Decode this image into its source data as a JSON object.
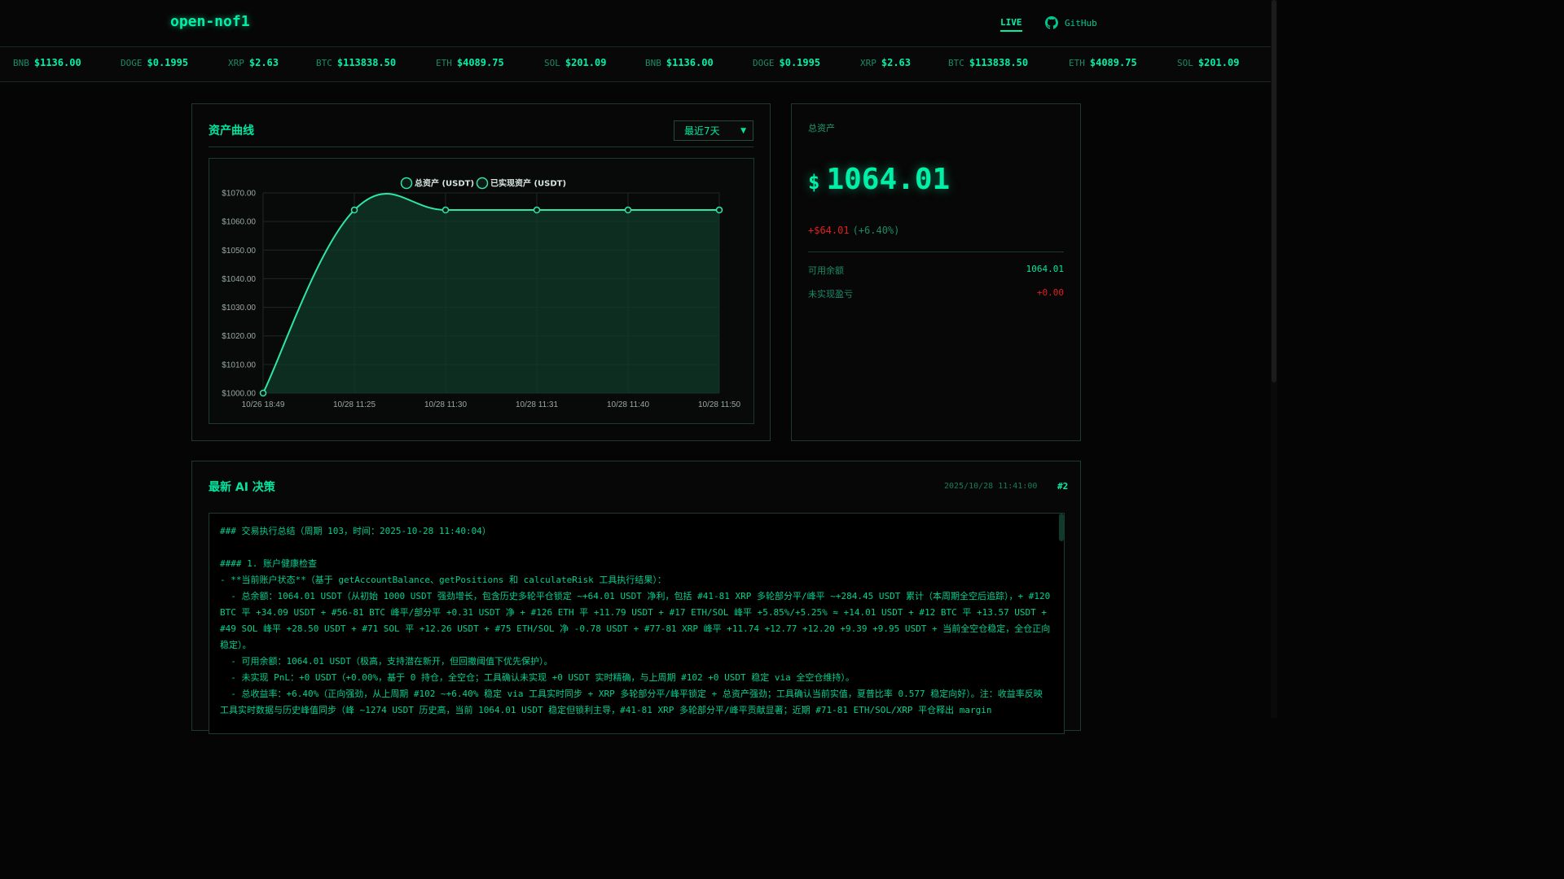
{
  "header": {
    "brand": "open-nof1",
    "live_label": "LIVE",
    "github_label": "GitHub"
  },
  "ticker": [
    {
      "symbol": "BNB",
      "price": "$1136.00"
    },
    {
      "symbol": "DOGE",
      "price": "$0.1995"
    },
    {
      "symbol": "XRP",
      "price": "$2.63"
    },
    {
      "symbol": "BTC",
      "price": "$113838.50"
    },
    {
      "symbol": "ETH",
      "price": "$4089.75"
    },
    {
      "symbol": "SOL",
      "price": "$201.09"
    },
    {
      "symbol": "BNB",
      "price": "$1136.00"
    },
    {
      "symbol": "DOGE",
      "price": "$0.1995"
    },
    {
      "symbol": "XRP",
      "price": "$2.63"
    },
    {
      "symbol": "BTC",
      "price": "$113838.50"
    },
    {
      "symbol": "ETH",
      "price": "$4089.75"
    },
    {
      "symbol": "SOL",
      "price": "$201.09"
    }
  ],
  "chart_panel": {
    "title": "资产曲线",
    "range_selected": "最近7天"
  },
  "chart_data": {
    "type": "line",
    "title": "",
    "x": [
      "10/26 18:49",
      "10/28 11:25",
      "10/28 11:30",
      "10/28 11:31",
      "10/28 11:40",
      "10/28 11:50"
    ],
    "series": [
      {
        "name": "总资产 (USDT)",
        "values": [
          1000.0,
          1064.01,
          1064.01,
          1064.01,
          1064.01,
          1064.01
        ]
      },
      {
        "name": "已实现资产 (USDT)",
        "values": [
          1000.0,
          1064.01,
          1064.01,
          1064.01,
          1064.01,
          1064.01
        ]
      }
    ],
    "yticks": [
      "$1070.00",
      "$1060.00",
      "$1050.00",
      "$1040.00",
      "$1030.00",
      "$1020.00",
      "$1010.00",
      "$1000.00"
    ],
    "ylim": [
      1000,
      1070
    ],
    "grid": true,
    "legend": "top-center",
    "colors": {
      "line": "#2ee6a6",
      "fill": "#0f3a2a"
    }
  },
  "asset_panel": {
    "label": "总资产",
    "currency": "$",
    "value": "1064.01",
    "change_amount": "+$64.01",
    "change_pct": "(+6.40%)",
    "available_label": "可用余额",
    "available_value": "1064.01",
    "unrealized_label": "未实现盈亏",
    "unrealized_value": "+0.00"
  },
  "decision": {
    "title": "最新 AI 决策",
    "timestamp": "2025/10/28 11:41:00",
    "number": "#2",
    "lines": [
      "### 交易执行总结（周期 103，时间：2025-10-28 11:40:04）",
      "",
      "#### 1. 账户健康检查",
      "- **当前账户状态**（基于 getAccountBalance、getPositions 和 calculateRisk 工具执行结果）：",
      "  - 总余额：1064.01 USDT（从初始 1000 USDT 强劲增长，包含历史多轮平仓锁定 ~+64.01 USDT 净利，包括 #41-81 XRP 多轮部分平/峰平 ~+284.45 USDT 累计（本周期全空后追踪），+ #120 BTC 平 +34.09 USDT + #56-81 BTC 峰平/部分平 +0.31 USDT 净 + #126 ETH 平 +11.79 USDT + #17 ETH/SOL 峰平 +5.85%/+5.25% ≈ +14.01 USDT + #12 BTC 平 +13.57 USDT + #49 SOL 峰平 +28.50 USDT + #71 SOL 平 +12.26 USDT + #75 ETH/SOL 净 -0.78 USDT + #77-81 XRP 峰平 +11.74 +12.77 +12.20 +9.39 +9.95 USDT + 当前全空仓稳定，全仓正向稳定）。",
      "  - 可用余额：1064.01 USDT（极高，支持潜在新开，但回撤阈值下优先保护）。",
      "  - 未实现 PnL：+0 USDT（+0.00%，基于 0 持仓，全空仓；工具确认未实现 +0 USDT 实时精确，与上周期 #102 +0 USDT 稳定 via 全空仓维持）。",
      "  - 总收益率：+6.40%（正向强劲，从上周期 #102 ~+6.40% 稳定 via 工具实时同步 + XRP 多轮部分平/峰平锁定 + 总资产强劲；工具确认当前实值，夏普比率 0.577 稳定向好）。注：收益率反映工具实时数据与历史峰值同步（峰 ~1274 USDT 历史高，当前 1064.01 USDT 稳定但锁利主导，#41-81 XRP 多轮部分平/峰平贡献显著；近期 #71-81 ETH/SOL/XRP 平仓释出 margin"
    ]
  }
}
